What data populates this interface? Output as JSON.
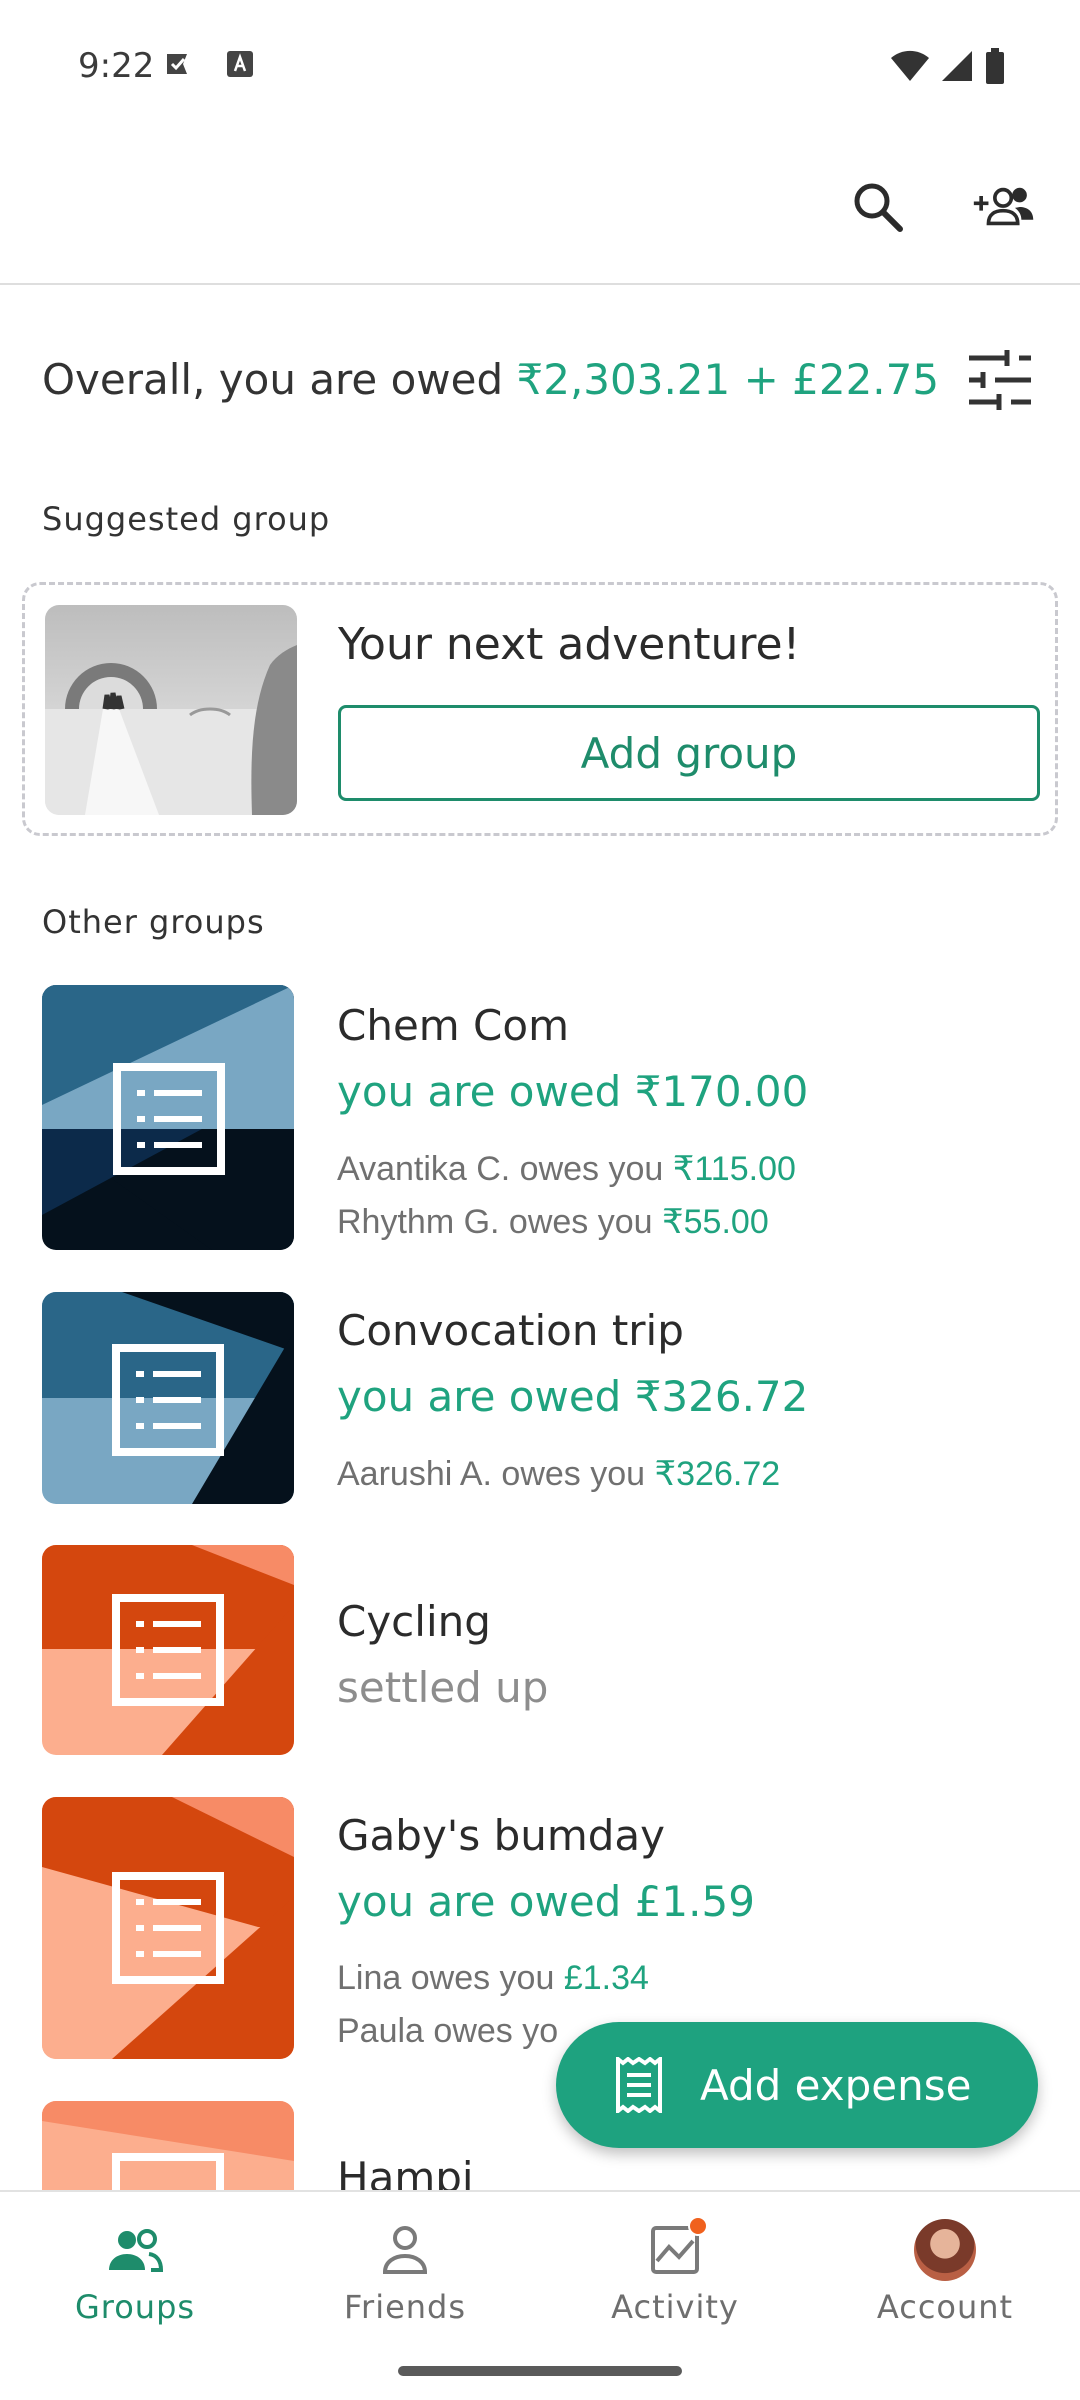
{
  "status_bar": {
    "time": "9:22"
  },
  "header": {
    "search_label": "Search",
    "add_friends_label": "Add friends"
  },
  "overall": {
    "prefix": "Overall, you are owed ",
    "amount": "₹2,303.21 + £22.75"
  },
  "suggested": {
    "section_label": "Suggested group",
    "title": "Your next adventure!",
    "button_label": "Add group"
  },
  "other_groups": {
    "section_label": "Other groups",
    "groups": [
      {
        "name": "Chem Com",
        "status": "you are owed ₹170.00",
        "details": [
          {
            "text": "Avantika C. owes you ",
            "amount": "₹115.00"
          },
          {
            "text": "Rhythm G. owes you ",
            "amount": "₹55.00"
          }
        ]
      },
      {
        "name": "Convocation trip",
        "status": "you are owed ₹326.72",
        "details": [
          {
            "text": "Aarushi A. owes you ",
            "amount": "₹326.72"
          }
        ]
      },
      {
        "name": "Cycling",
        "status": "settled up",
        "details": []
      },
      {
        "name": "Gaby's bumday",
        "status": "you are owed £1.59",
        "details": [
          {
            "text": "Lina owes you ",
            "amount": "£1.34"
          },
          {
            "text": "Paula owes yo",
            "amount": ""
          }
        ]
      },
      {
        "name": "Hampi",
        "status": "",
        "details": []
      }
    ]
  },
  "fab": {
    "label": "Add expense"
  },
  "bottom_nav": {
    "items": [
      {
        "label": "Groups",
        "active": true
      },
      {
        "label": "Friends",
        "active": false
      },
      {
        "label": "Activity",
        "active": false
      },
      {
        "label": "Account",
        "active": false
      }
    ]
  },
  "colors": {
    "accent": "#1fa37f",
    "accent_dark": "#1e8c6b",
    "blue_dark": "#04101b",
    "blue_mid": "#2a6688",
    "blue_light": "#79a7c3",
    "orange_dark": "#d4470e",
    "orange_light": "#fcae8e",
    "notification": "#f0611e"
  }
}
